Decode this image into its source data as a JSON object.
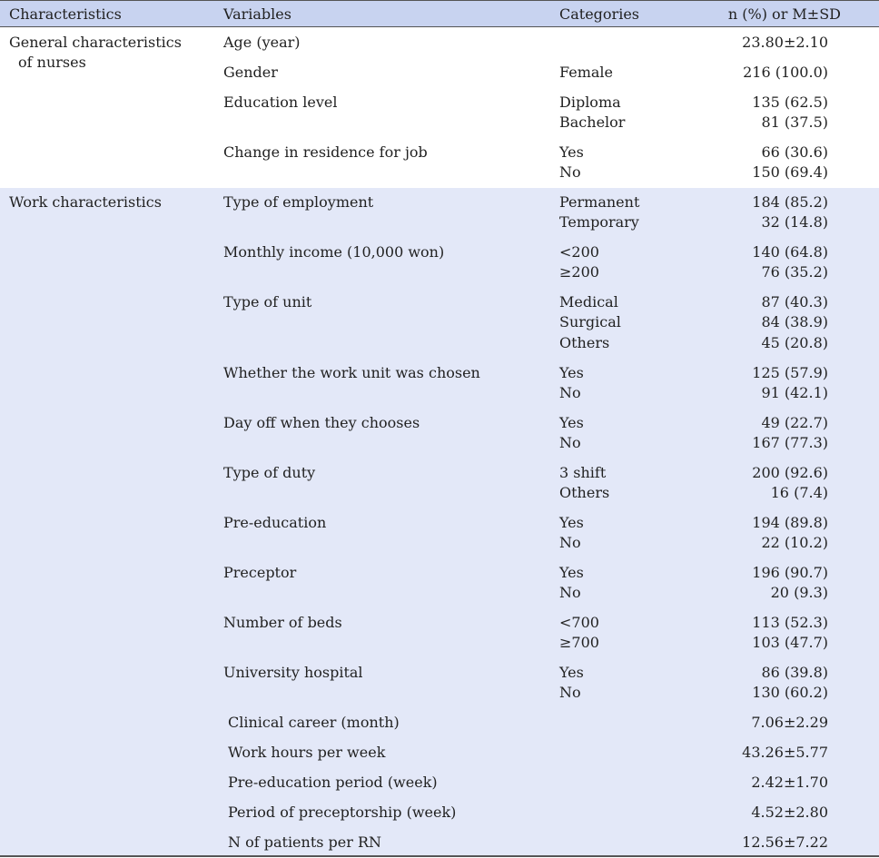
{
  "header": {
    "characteristics": "Characteristics",
    "variables": "Variables",
    "categories": "Categories",
    "value": "n (%) or M±SD"
  },
  "group1": {
    "title_line1": "General characteristics",
    "title_line2": "of nurses",
    "rows": [
      {
        "variable": "Age (year)",
        "cats": [
          ""
        ],
        "vals": [
          "23.80±2.10"
        ]
      },
      {
        "variable": "Gender",
        "cats": [
          "Female"
        ],
        "vals": [
          "216 (100.0)"
        ]
      },
      {
        "variable": "Education level",
        "cats": [
          "Diploma",
          "Bachelor"
        ],
        "vals": [
          "135 (62.5)",
          "81 (37.5)"
        ]
      },
      {
        "variable": "Change in residence for job",
        "cats": [
          "Yes",
          "No"
        ],
        "vals": [
          "66 (30.6)",
          "150 (69.4)"
        ]
      }
    ]
  },
  "group2": {
    "title": "Work characteristics",
    "rows": [
      {
        "variable": "Type of employment",
        "cats": [
          "Permanent",
          "Temporary"
        ],
        "vals": [
          "184 (85.2)",
          "32 (14.8)"
        ]
      },
      {
        "variable": "Monthly income (10,000 won)",
        "cats": [
          "<200",
          "≥200"
        ],
        "vals": [
          "140 (64.8)",
          "76 (35.2)"
        ]
      },
      {
        "variable": "Type of unit",
        "cats": [
          "Medical",
          "Surgical",
          "Others"
        ],
        "vals": [
          "87 (40.3)",
          "84 (38.9)",
          "45 (20.8)"
        ]
      },
      {
        "variable": "Whether the work unit was chosen",
        "cats": [
          "Yes",
          "No"
        ],
        "vals": [
          "125 (57.9)",
          "91 (42.1)"
        ]
      },
      {
        "variable": "Day off when they chooses",
        "cats": [
          "Yes",
          "No"
        ],
        "vals": [
          "49 (22.7)",
          "167 (77.3)"
        ]
      },
      {
        "variable": "Type of duty",
        "cats": [
          "3 shift",
          "Others"
        ],
        "vals": [
          "200 (92.6)",
          "16 (7.4)"
        ]
      },
      {
        "variable": "Pre-education",
        "cats": [
          "Yes",
          "No"
        ],
        "vals": [
          "194 (89.8)",
          "22 (10.2)"
        ]
      },
      {
        "variable": "Preceptor",
        "cats": [
          "Yes",
          "No"
        ],
        "vals": [
          "196 (90.7)",
          "20 (9.3)"
        ]
      },
      {
        "variable": "Number of beds",
        "cats": [
          "<700",
          "≥700"
        ],
        "vals": [
          "113 (52.3)",
          "103 (47.7)"
        ]
      },
      {
        "variable": "University hospital",
        "cats": [
          "Yes",
          "No"
        ],
        "vals": [
          "86 (39.8)",
          "130 (60.2)"
        ]
      },
      {
        "variable": "Clinical career (month)",
        "cats": [
          ""
        ],
        "vals": [
          "7.06±2.29"
        ]
      },
      {
        "variable": "Work hours per week",
        "cats": [
          ""
        ],
        "vals": [
          "43.26±5.77"
        ]
      },
      {
        "variable": "Pre-education period (week)",
        "cats": [
          ""
        ],
        "vals": [
          "2.42±1.70"
        ]
      },
      {
        "variable": "Period of preceptorship (week)",
        "cats": [
          ""
        ],
        "vals": [
          "4.52±2.80"
        ]
      },
      {
        "variable": "N of patients per RN",
        "cats": [
          ""
        ],
        "vals": [
          "12.56±7.22"
        ]
      }
    ]
  }
}
